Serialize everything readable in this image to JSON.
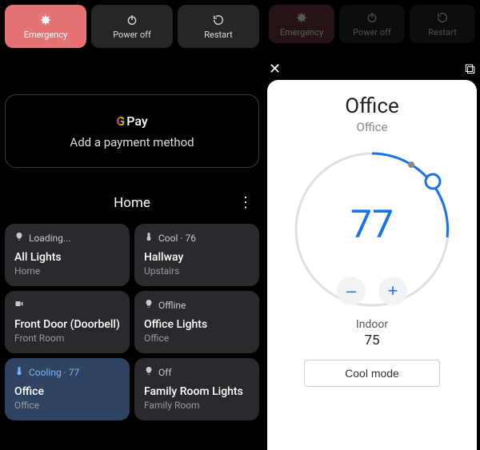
{
  "power_buttons": {
    "emergency": "Emergency",
    "power_off": "Power off",
    "restart": "Restart"
  },
  "pay": {
    "brand_g": "G",
    "brand_rest": " Pay",
    "cta": "Add a payment method"
  },
  "home": {
    "title": "Home"
  },
  "tiles": [
    {
      "status": "Loading...",
      "name": "All Lights",
      "sub": "Home",
      "icon": "bulb"
    },
    {
      "status": "Cool · 76",
      "name": "Hallway",
      "sub": "Upstairs",
      "icon": "thermo"
    },
    {
      "status": "",
      "name": "Front Door (Doorbell)",
      "sub": "Front Room",
      "icon": "camera"
    },
    {
      "status": "Offline",
      "name": "Office Lights",
      "sub": "Office",
      "icon": "bulb"
    },
    {
      "status": "Cooling · 77",
      "name": "Office",
      "sub": "Office",
      "icon": "thermo",
      "active": true
    },
    {
      "status": "Off",
      "name": "Family Room Lights",
      "sub": "Family Room",
      "icon": "bulb"
    }
  ],
  "thermo": {
    "title": "Office",
    "room": "Office",
    "setpoint": "77",
    "indoor_label": "Indoor",
    "indoor_value": "75",
    "mode_label": "Cool mode",
    "minus": "–",
    "plus": "+"
  }
}
